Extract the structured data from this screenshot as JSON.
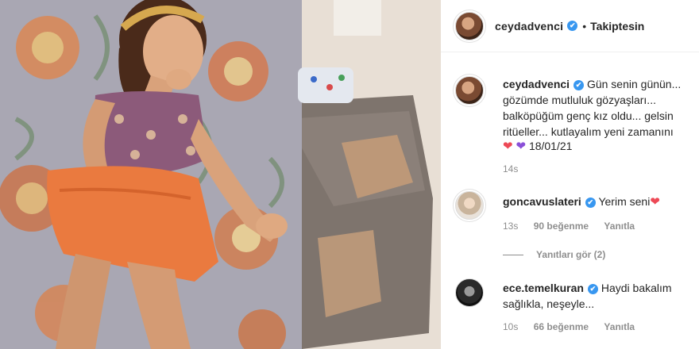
{
  "post_header": {
    "username": "ceydadvenci",
    "verified_icon": "✔",
    "follow_state": "Takiptesin"
  },
  "caption": {
    "username": "ceydadvenci",
    "lines": [
      "Gün senin günün...",
      "gözümde mutluluk gözyaşları...",
      "balköpüğüm genç kız oldu... gelsin",
      "ritüeller... kutlayalım yeni zamanını"
    ],
    "date": "18/01/21",
    "time": "14s"
  },
  "comments": [
    {
      "username": "goncavuslateri",
      "text": "Yerim seni",
      "time": "13s",
      "likes": "90 beğenme",
      "reply": "Yanıtla",
      "view_replies": "Yanıtları gör (2)"
    },
    {
      "username": "ece.temelkuran",
      "text_line1": "Haydi bakalım",
      "text_line2": "sağlıkla, neşeyle...",
      "time": "10s",
      "likes": "66 beğenme",
      "reply": "Yanıtla"
    }
  ],
  "icons": {
    "verified": "verified-badge-icon",
    "heart_red": "red-heart-icon",
    "heart_purple": "purple-heart-icon"
  },
  "colors": {
    "verified_blue": "#3897f0",
    "heart_red": "#ed4956",
    "heart_purple": "#8a4fd8",
    "muted_text": "#8e8e8e"
  }
}
